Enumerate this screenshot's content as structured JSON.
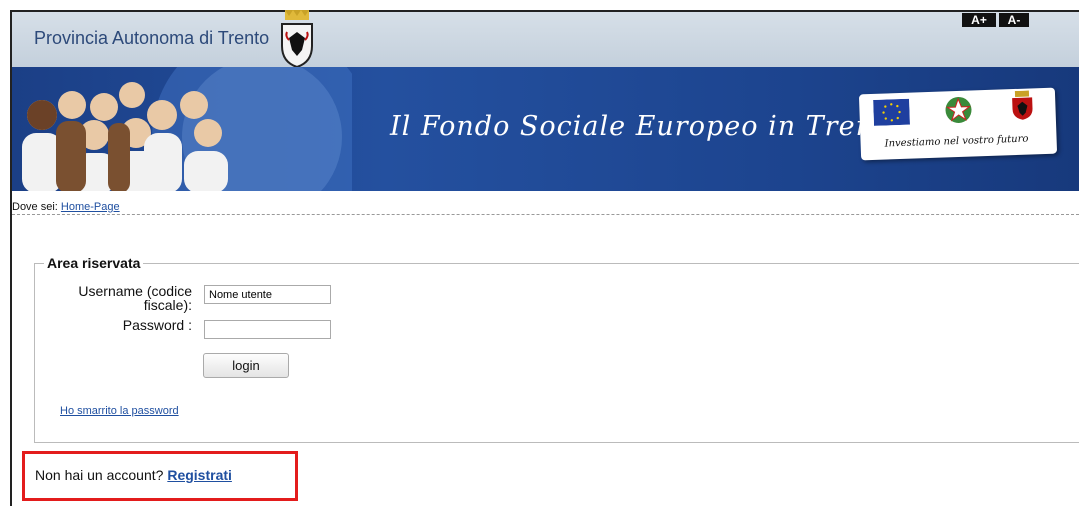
{
  "header": {
    "title": "Provincia Autonoma di Trento",
    "font_increase": "A+",
    "font_decrease": "A-"
  },
  "banner": {
    "title": "Il Fondo Sociale Europeo in Trentino",
    "card_caption": "Investiamo nel vostro futuro"
  },
  "breadcrumb": {
    "label": "Dove sei:",
    "link": "Home-Page"
  },
  "login": {
    "legend": "Area riservata",
    "username_label_line1": "Username (codice",
    "username_label_line2": "fiscale):",
    "username_value": "Nome utente",
    "password_label": "Password :",
    "password_value": "",
    "login_button": "login",
    "forgot_link": "Ho smarrito la password"
  },
  "register": {
    "text": "Non hai un account?",
    "link": "Registrati"
  },
  "colors": {
    "banner": "#1d4590",
    "link": "#1f4fa0",
    "highlight": "#e31c1c"
  }
}
